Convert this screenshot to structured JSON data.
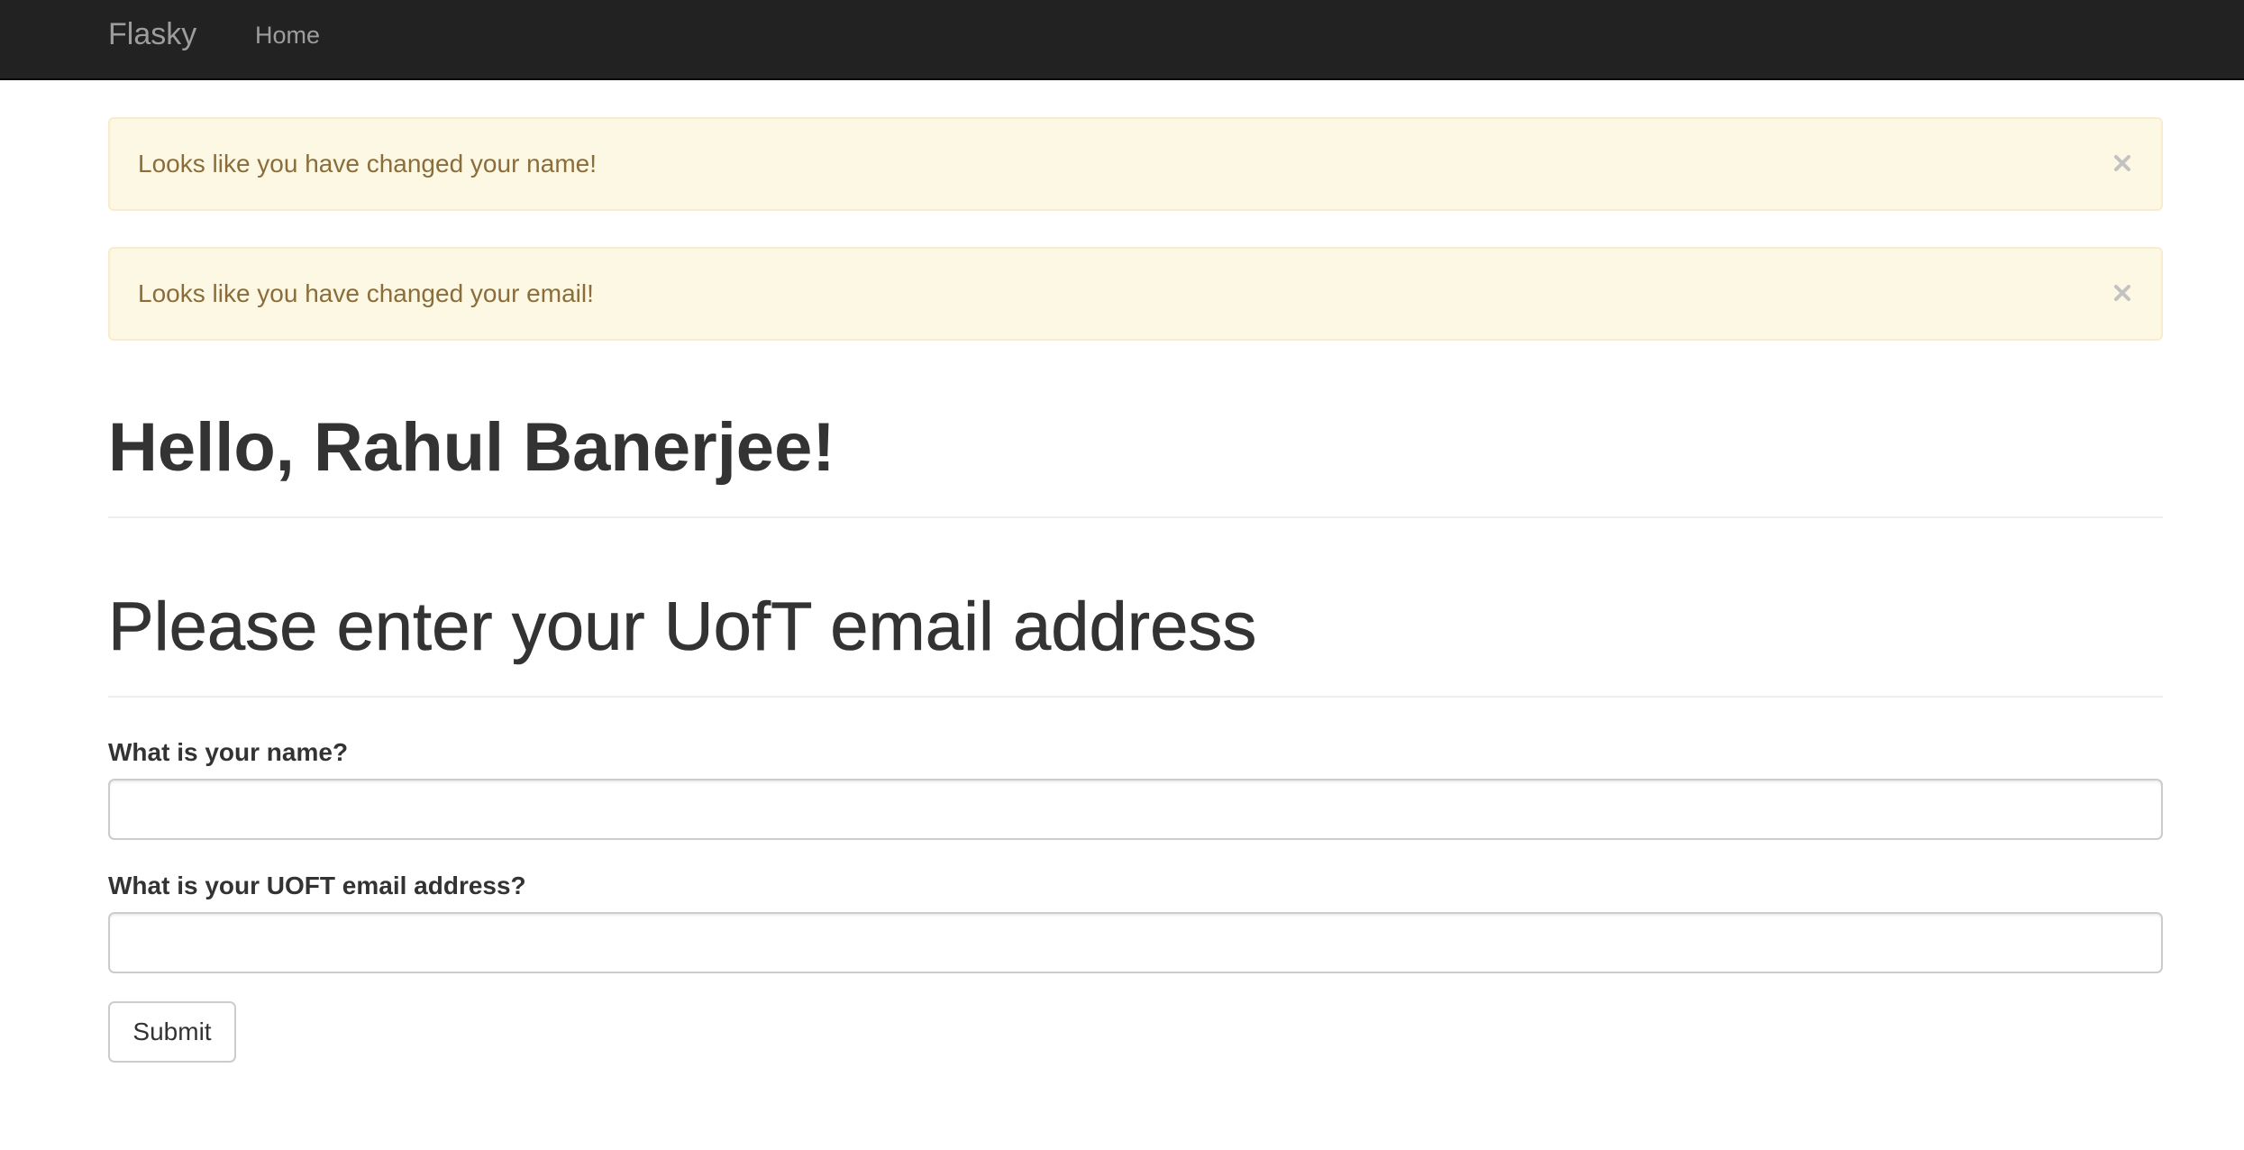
{
  "navbar": {
    "brand": "Flasky",
    "links": [
      {
        "label": "Home"
      }
    ]
  },
  "alerts": [
    {
      "message": "Looks like you have changed your name!",
      "close_icon": "close-icon"
    },
    {
      "message": "Looks like you have changed your email!",
      "close_icon": "close-icon"
    }
  ],
  "page": {
    "greeting": "Hello, Rahul Banerjee!",
    "form_title": "Please enter your UofT email address"
  },
  "form": {
    "name_label": "What is your name?",
    "name_value": "",
    "email_label": "What is your UOFT email address?",
    "email_value": "",
    "submit_label": "Submit"
  },
  "colors": {
    "navbar_bg": "#222222",
    "navbar_text": "#9d9d9d",
    "alert_bg": "#fcf8e3",
    "alert_border": "#faebcc",
    "alert_text": "#8a6d3b",
    "heading_text": "#333333"
  }
}
